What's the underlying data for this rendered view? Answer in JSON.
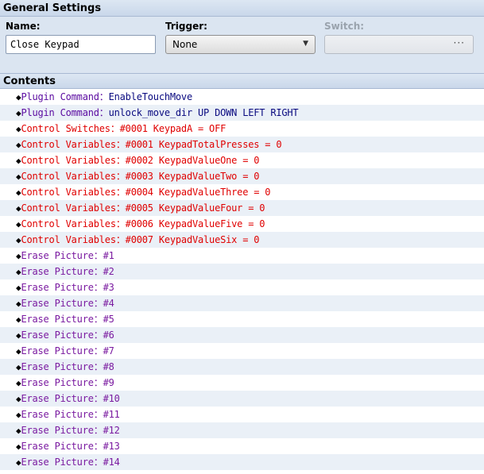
{
  "general_settings": {
    "header": "General Settings",
    "name_label": "Name:",
    "name_value": "Close Keypad",
    "trigger_label": "Trigger:",
    "trigger_value": "None",
    "switch_label": "Switch:",
    "switch_button": "···"
  },
  "contents": {
    "header": "Contents",
    "diamond": "◆",
    "rows": [
      {
        "cmd": "Plugin Command",
        "sep": "：",
        "val": "EnableTouchMove",
        "kind": "plugin"
      },
      {
        "cmd": "Plugin Command",
        "sep": "：",
        "val": "unlock_move_dir UP DOWN LEFT RIGHT",
        "kind": "plugin"
      },
      {
        "cmd": "Control Switches",
        "sep": "：",
        "val": "#0001 KeypadA = OFF",
        "kind": "control"
      },
      {
        "cmd": "Control Variables",
        "sep": "：",
        "val": "#0001 KeypadTotalPresses = 0",
        "kind": "control"
      },
      {
        "cmd": "Control Variables",
        "sep": "：",
        "val": "#0002 KeypadValueOne = 0",
        "kind": "control"
      },
      {
        "cmd": "Control Variables",
        "sep": "：",
        "val": "#0003 KeypadValueTwo = 0",
        "kind": "control"
      },
      {
        "cmd": "Control Variables",
        "sep": "：",
        "val": "#0004 KeypadValueThree = 0",
        "kind": "control"
      },
      {
        "cmd": "Control Variables",
        "sep": "：",
        "val": "#0005 KeypadValueFour = 0",
        "kind": "control"
      },
      {
        "cmd": "Control Variables",
        "sep": "：",
        "val": "#0006 KeypadValueFive = 0",
        "kind": "control"
      },
      {
        "cmd": "Control Variables",
        "sep": "：",
        "val": "#0007 KeypadValueSix = 0",
        "kind": "control"
      },
      {
        "cmd": "Erase Picture",
        "sep": "：",
        "val": "#1",
        "kind": "erase"
      },
      {
        "cmd": "Erase Picture",
        "sep": "：",
        "val": "#2",
        "kind": "erase"
      },
      {
        "cmd": "Erase Picture",
        "sep": "：",
        "val": "#3",
        "kind": "erase"
      },
      {
        "cmd": "Erase Picture",
        "sep": "：",
        "val": "#4",
        "kind": "erase"
      },
      {
        "cmd": "Erase Picture",
        "sep": "：",
        "val": "#5",
        "kind": "erase"
      },
      {
        "cmd": "Erase Picture",
        "sep": "：",
        "val": "#6",
        "kind": "erase"
      },
      {
        "cmd": "Erase Picture",
        "sep": "：",
        "val": "#7",
        "kind": "erase"
      },
      {
        "cmd": "Erase Picture",
        "sep": "：",
        "val": "#8",
        "kind": "erase"
      },
      {
        "cmd": "Erase Picture",
        "sep": "：",
        "val": "#9",
        "kind": "erase"
      },
      {
        "cmd": "Erase Picture",
        "sep": "：",
        "val": "#10",
        "kind": "erase"
      },
      {
        "cmd": "Erase Picture",
        "sep": "：",
        "val": "#11",
        "kind": "erase"
      },
      {
        "cmd": "Erase Picture",
        "sep": "：",
        "val": "#12",
        "kind": "erase"
      },
      {
        "cmd": "Erase Picture",
        "sep": "：",
        "val": "#13",
        "kind": "erase"
      },
      {
        "cmd": "Erase Picture",
        "sep": "：",
        "val": "#14",
        "kind": "erase"
      }
    ]
  },
  "colors": {
    "plugin_command": "#5a0aa0",
    "control": "#e00000",
    "erase_picture": "#7a1aa0",
    "panel_bg": "#dbe5f1",
    "alt_row": "#eaf0f7"
  }
}
